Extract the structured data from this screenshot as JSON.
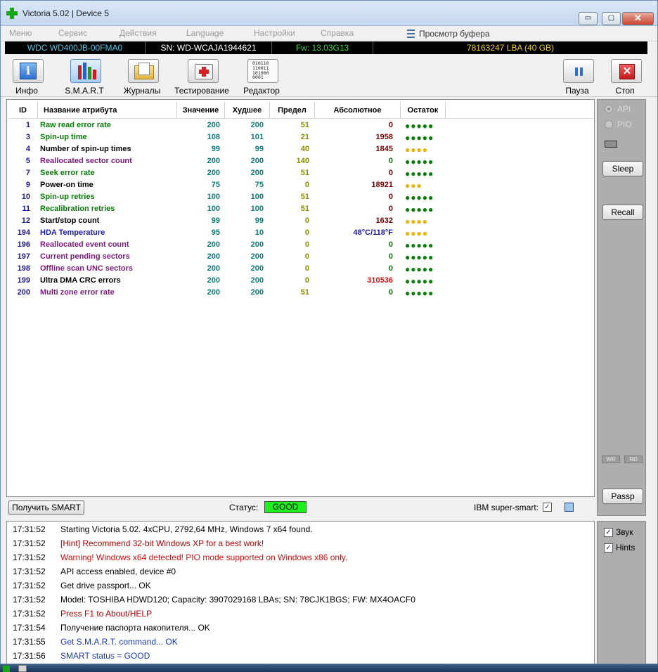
{
  "window": {
    "title": "Victoria 5.02 | Device 5",
    "min_glyph": "▭",
    "max_glyph": "▢",
    "close_glyph": "✕"
  },
  "menu": {
    "items": [
      "Меню",
      "Сервис",
      "Действия",
      "Language",
      "Настройки",
      "Справка"
    ],
    "buffer": "Просмотр буфера"
  },
  "drive": {
    "model": "WDC WD400JB-00FMA0",
    "serial": "SN: WD-WCAJA1944621",
    "firmware": "Fw: 13.03G13",
    "capacity": "78163247 LBA (40 GB)"
  },
  "toolbar": {
    "info": "Инфо",
    "smart": "S.M.A.R.T",
    "journals": "Журналы",
    "testing": "Тестирование",
    "editor": "Редактор",
    "pause": "Пауза",
    "stop": "Стоп",
    "editor_icon_text": "010110\n110011\n101000\n0001"
  },
  "smart_table": {
    "headers": {
      "id": "ID",
      "name": "Название атрибута",
      "value": "Значение",
      "worst": "Худшее",
      "threshold": "Предел",
      "raw": "Абсолютное",
      "remaining": "Остаток"
    },
    "rows": [
      {
        "id": "1",
        "name": "Raw read error rate",
        "value": "200",
        "worst": "200",
        "threshold": "51",
        "raw": "0",
        "dots": "●●●●●",
        "name_color": "#0a7a0a",
        "raw_color": "#7a0000",
        "dots_color": "#0a7a0a"
      },
      {
        "id": "3",
        "name": "Spin-up time",
        "value": "108",
        "worst": "101",
        "threshold": "21",
        "raw": "1958",
        "dots": "●●●●●",
        "name_color": "#0a7a0a",
        "raw_color": "#7a0000",
        "dots_color": "#0a7a0a"
      },
      {
        "id": "4",
        "name": "Number of spin-up times",
        "value": "99",
        "worst": "99",
        "threshold": "40",
        "raw": "1845",
        "dots": "●●●●",
        "name_color": "#000000",
        "raw_color": "#7a0000",
        "dots_color": "#e8b400"
      },
      {
        "id": "5",
        "name": "Reallocated sector count",
        "value": "200",
        "worst": "200",
        "threshold": "140",
        "raw": "0",
        "dots": "●●●●●",
        "name_color": "#7a1a7a",
        "raw_color": "#0a7a0a",
        "dots_color": "#0a7a0a"
      },
      {
        "id": "7",
        "name": "Seek error rate",
        "value": "200",
        "worst": "200",
        "threshold": "51",
        "raw": "0",
        "dots": "●●●●●",
        "name_color": "#0a7a0a",
        "raw_color": "#7a0000",
        "dots_color": "#0a7a0a"
      },
      {
        "id": "9",
        "name": "Power-on time",
        "value": "75",
        "worst": "75",
        "threshold": "0",
        "raw": "18921",
        "dots": "●●●",
        "name_color": "#000000",
        "raw_color": "#7a0000",
        "dots_color": "#e8b400"
      },
      {
        "id": "10",
        "name": "Spin-up retries",
        "value": "100",
        "worst": "100",
        "threshold": "51",
        "raw": "0",
        "dots": "●●●●●",
        "name_color": "#0a7a0a",
        "raw_color": "#7a0000",
        "dots_color": "#0a7a0a"
      },
      {
        "id": "11",
        "name": "Recalibration retries",
        "value": "100",
        "worst": "100",
        "threshold": "51",
        "raw": "0",
        "dots": "●●●●●",
        "name_color": "#0a7a0a",
        "raw_color": "#7a0000",
        "dots_color": "#0a7a0a"
      },
      {
        "id": "12",
        "name": "Start/stop count",
        "value": "99",
        "worst": "99",
        "threshold": "0",
        "raw": "1632",
        "dots": "●●●●",
        "name_color": "#000000",
        "raw_color": "#7a0000",
        "dots_color": "#e8b400"
      },
      {
        "id": "194",
        "name": "HDA Temperature",
        "value": "95",
        "worst": "10",
        "threshold": "0",
        "raw": "48°C/118°F",
        "dots": "●●●●",
        "name_color": "#1a1aa8",
        "raw_color": "#1a1aa8",
        "dots_color": "#e8b400"
      },
      {
        "id": "196",
        "name": "Reallocated event count",
        "value": "200",
        "worst": "200",
        "threshold": "0",
        "raw": "0",
        "dots": "●●●●●",
        "name_color": "#7a1a7a",
        "raw_color": "#0a7a0a",
        "dots_color": "#0a7a0a"
      },
      {
        "id": "197",
        "name": "Current pending sectors",
        "value": "200",
        "worst": "200",
        "threshold": "0",
        "raw": "0",
        "dots": "●●●●●",
        "name_color": "#7a1a7a",
        "raw_color": "#0a7a0a",
        "dots_color": "#0a7a0a"
      },
      {
        "id": "198",
        "name": "Offline scan UNC sectors",
        "value": "200",
        "worst": "200",
        "threshold": "0",
        "raw": "0",
        "dots": "●●●●●",
        "name_color": "#7a1a7a",
        "raw_color": "#0a7a0a",
        "dots_color": "#0a7a0a"
      },
      {
        "id": "199",
        "name": "Ultra DMA CRC errors",
        "value": "200",
        "worst": "200",
        "threshold": "0",
        "raw": "310536",
        "dots": "●●●●●",
        "name_color": "#000000",
        "raw_color": "#e01010",
        "dots_color": "#0a7a0a"
      },
      {
        "id": "200",
        "name": "Multi zone error rate",
        "value": "200",
        "worst": "200",
        "threshold": "51",
        "raw": "0",
        "dots": "●●●●●",
        "name_color": "#7a1a7a",
        "raw_color": "#0a7a0a",
        "dots_color": "#0a7a0a"
      }
    ]
  },
  "status_bar": {
    "get_smart": "Получить SMART",
    "status_label": "Статус:",
    "status_value": "GOOD",
    "ibm_label": "IBM super-smart:",
    "ibm_checked": "✓"
  },
  "side": {
    "api": "API",
    "pio": "PIO",
    "sleep": "Sleep",
    "recall": "Recall",
    "wr": "WR",
    "rd": "RD",
    "passp": "Passp",
    "sound": "Звук",
    "hints": "Hints",
    "check_mark": "✓"
  },
  "log": [
    {
      "time": "17:31:52",
      "msg": "Starting Victoria 5.02. 4xCPU, 2792,64 MHz, Windows 7 x64 found.",
      "color": "#000000"
    },
    {
      "time": "17:31:52",
      "msg": "[Hint] Recommend 32-bit Windows XP for a best work!",
      "color": "#b00000"
    },
    {
      "time": "17:31:52",
      "msg": "Warning! Windows x64 detected! PIO mode supported on Windows x86 only.",
      "color": "#d01010"
    },
    {
      "time": "17:31:52",
      "msg": "API access enabled, device #0",
      "color": "#000000"
    },
    {
      "time": "17:31:52",
      "msg": "Get drive passport... OK",
      "color": "#000000"
    },
    {
      "time": "17:31:52",
      "msg": "Model: TOSHIBA HDWD120; Capacity: 3907029168 LBAs; SN: 78CJK1BGS; FW: MX4OACF0",
      "color": "#000000"
    },
    {
      "time": "17:31:52",
      "msg": "Press F1 to About/HELP",
      "color": "#b00000"
    },
    {
      "time": "17:31:54",
      "msg": "Получение паспорта накопителя... OK",
      "color": "#000000"
    },
    {
      "time": "17:31:55",
      "msg": "Get S.M.A.R.T. command... OK",
      "color": "#1a3ab0"
    },
    {
      "time": "17:31:56",
      "msg": "SMART status = GOOD",
      "color": "#1a3ab0"
    }
  ]
}
